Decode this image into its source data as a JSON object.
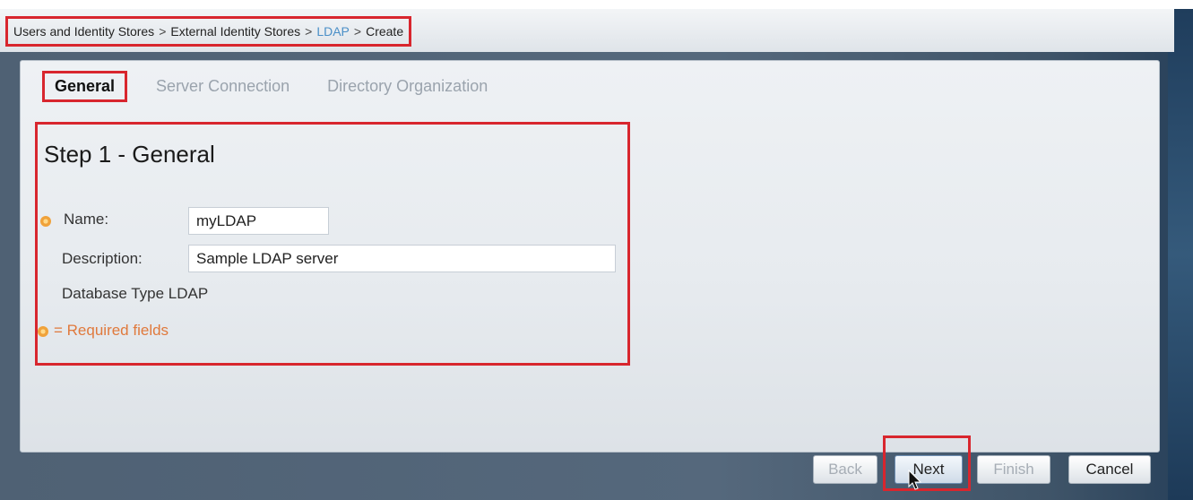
{
  "breadcrumb": {
    "items": [
      "Users and Identity Stores",
      "External Identity Stores",
      "LDAP",
      "Create"
    ],
    "separator": ">"
  },
  "tabs": [
    {
      "label": "General",
      "active": true
    },
    {
      "label": "Server Connection",
      "active": false
    },
    {
      "label": "Directory Organization",
      "active": false
    }
  ],
  "step": {
    "title": "Step 1 - General",
    "name_label": "Name:",
    "name_value": "myLDAP",
    "description_label": "Description:",
    "description_value": "Sample LDAP server",
    "database_type_label": "Database Type",
    "database_type_value": "LDAP",
    "required_note": "= Required fields"
  },
  "buttons": {
    "back": "Back",
    "next": "Next",
    "finish": "Finish",
    "cancel": "Cancel"
  },
  "colors": {
    "highlight": "#d8262e",
    "link": "#4a8fc7",
    "required": "#e0793c",
    "required_icon": "#f0a23a"
  }
}
